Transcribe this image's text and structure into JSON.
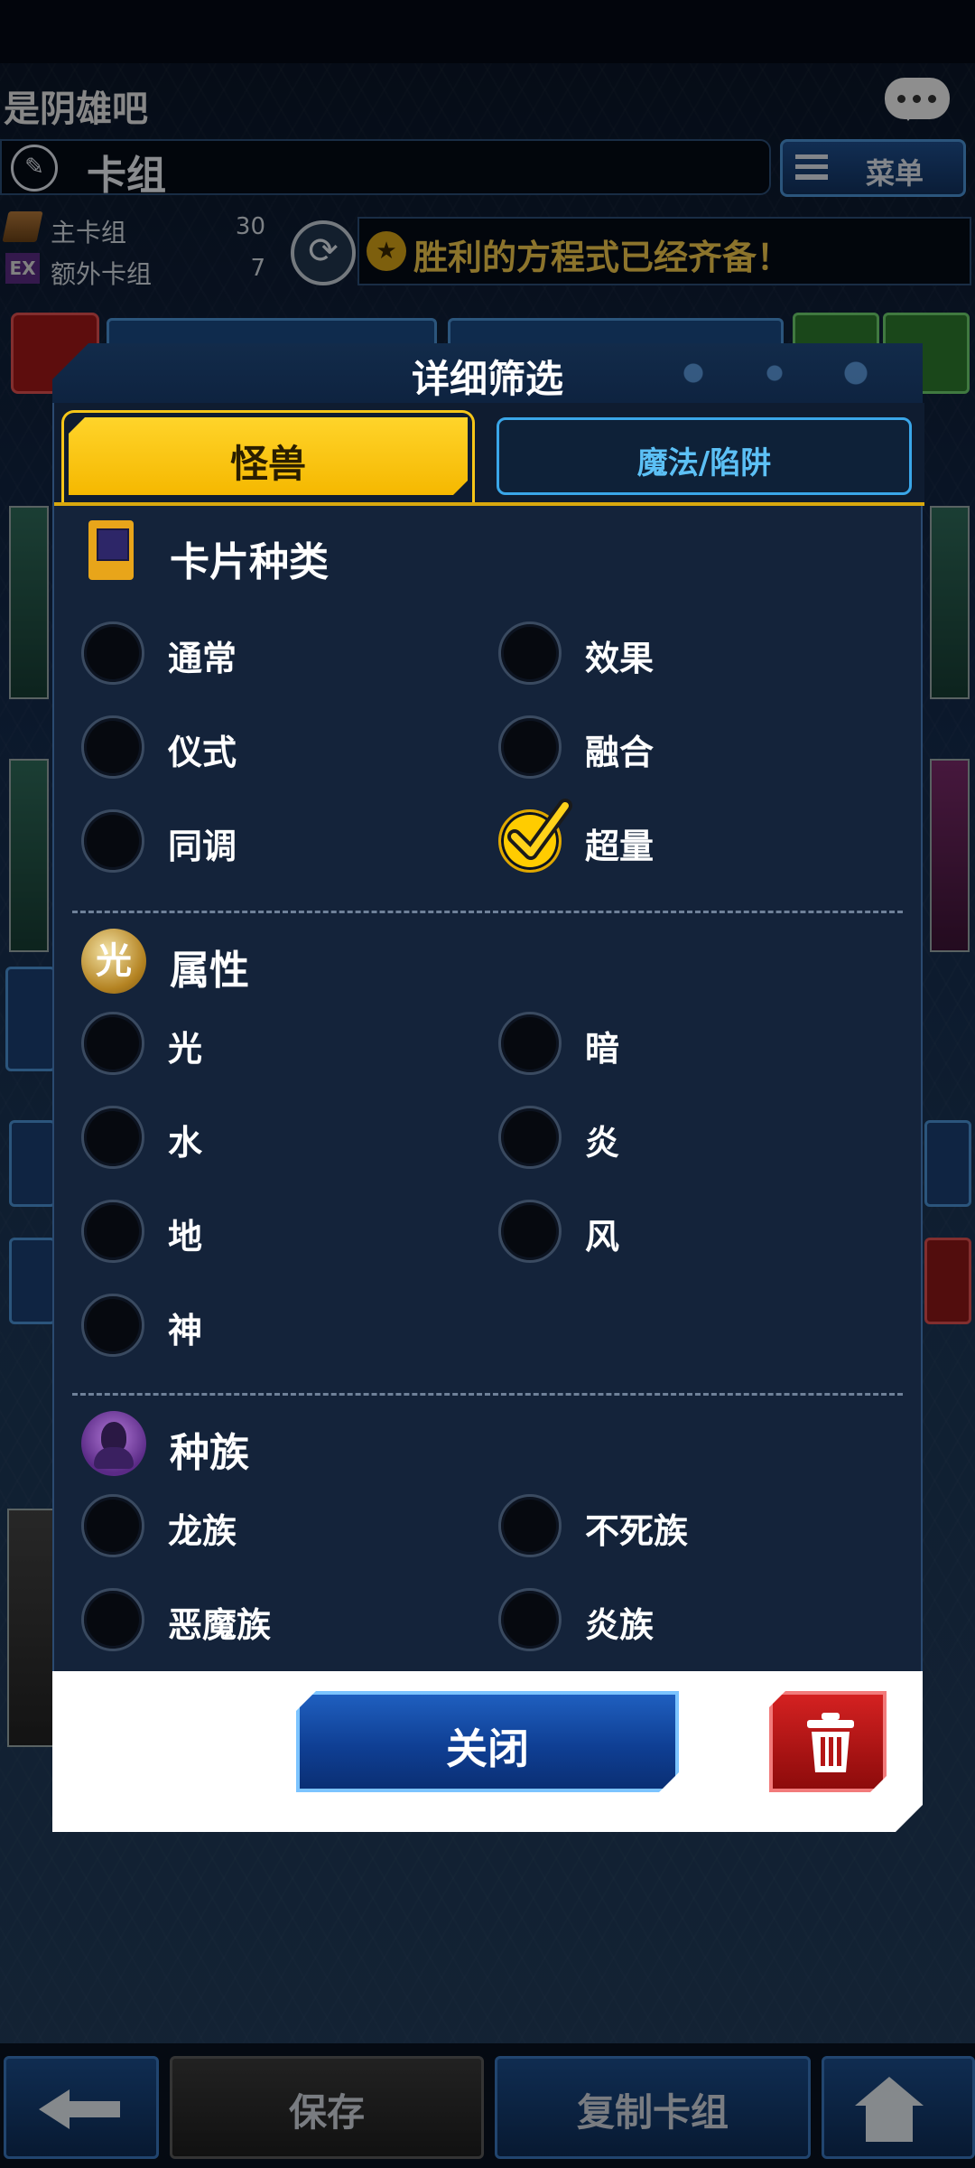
{
  "background": {
    "channel_name": "是阴雄吧",
    "deck_title": "卡组",
    "menu_label": "菜单",
    "main_deck": {
      "icon_text": "",
      "label": "主卡组",
      "count": "30"
    },
    "extra_deck": {
      "icon_text": "EX",
      "label": "额外卡组",
      "count": "7"
    },
    "banner_text": "胜利的方程式已经齐备！",
    "bottom_nav": {
      "back_icon": "arrow-left-icon",
      "save_label": "保存",
      "copy_label": "复制卡组",
      "home_icon": "home-icon"
    }
  },
  "modal": {
    "title": "详细筛选",
    "tabs": [
      {
        "label": "怪兽",
        "active": true
      },
      {
        "label": "魔法/陷阱",
        "active": false
      }
    ],
    "sections": [
      {
        "title": "卡片种类",
        "icon": "card-type-icon",
        "options": [
          {
            "label": "通常",
            "checked": false
          },
          {
            "label": "效果",
            "checked": false
          },
          {
            "label": "仪式",
            "checked": false
          },
          {
            "label": "融合",
            "checked": false
          },
          {
            "label": "同调",
            "checked": false
          },
          {
            "label": "超量",
            "checked": true
          }
        ]
      },
      {
        "title": "属性",
        "icon": "light-attribute-icon",
        "icon_text": "光",
        "options": [
          {
            "label": "光",
            "checked": false
          },
          {
            "label": "暗",
            "checked": false
          },
          {
            "label": "水",
            "checked": false
          },
          {
            "label": "炎",
            "checked": false
          },
          {
            "label": "地",
            "checked": false
          },
          {
            "label": "风",
            "checked": false
          },
          {
            "label": "神",
            "checked": false
          }
        ]
      },
      {
        "title": "种族",
        "icon": "spellcaster-race-icon",
        "options": [
          {
            "label": "龙族",
            "checked": false
          },
          {
            "label": "不死族",
            "checked": false
          },
          {
            "label": "恶魔族",
            "checked": false
          },
          {
            "label": "炎族",
            "checked": false
          }
        ]
      }
    ],
    "close_label": "关闭",
    "delete_icon": "trash-icon"
  },
  "colors": {
    "accent_yellow": "#ffcc00",
    "tab_inactive_text": "#5cc0f5",
    "close_button": "#0f3f94",
    "delete_button": "#b51515"
  }
}
